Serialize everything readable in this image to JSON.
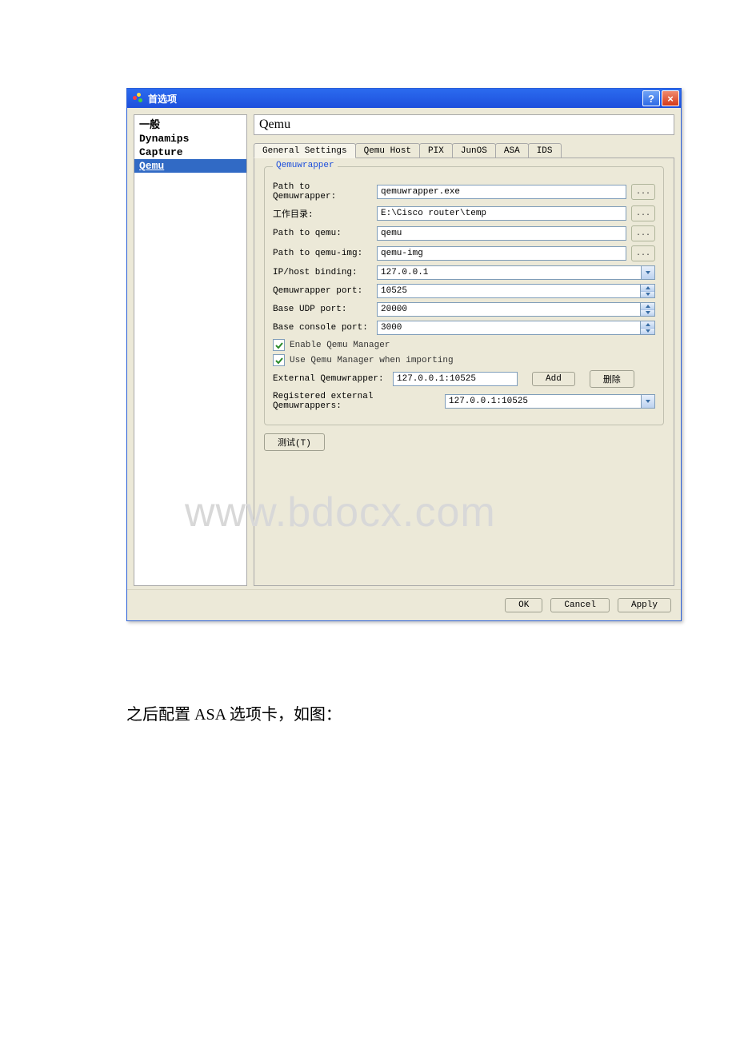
{
  "titlebar": {
    "title": "首选项"
  },
  "sidebar": {
    "items": [
      {
        "label": "一般"
      },
      {
        "label": "Dynamips"
      },
      {
        "label": "Capture"
      },
      {
        "label": "Qemu"
      }
    ]
  },
  "page_title": "Qemu",
  "tabs": [
    {
      "label": "General Settings"
    },
    {
      "label": "Qemu Host"
    },
    {
      "label": "PIX"
    },
    {
      "label": "JunOS"
    },
    {
      "label": "ASA"
    },
    {
      "label": "IDS"
    }
  ],
  "group": {
    "title": "Qemuwrapper",
    "path_qemuwrapper_label": "Path to Qemuwrapper:",
    "path_qemuwrapper_value": "qemuwrapper.exe",
    "workdir_label": "工作目录:",
    "workdir_value": "E:\\Cisco router\\temp",
    "path_qemu_label": "Path to qemu:",
    "path_qemu_value": "qemu",
    "path_qemuimg_label": "Path to qemu-img:",
    "path_qemuimg_value": "qemu-img",
    "ipbind_label": "IP/host binding:",
    "ipbind_value": "127.0.0.1",
    "wrapperport_label": "Qemuwrapper port:",
    "wrapperport_value": "10525",
    "baseudp_label": "Base UDP port:",
    "baseudp_value": "20000",
    "baseconsole_label": "Base console port:",
    "baseconsole_value": "3000",
    "enable_manager_label": "Enable Qemu Manager",
    "use_manager_import_label": "Use Qemu Manager when importing",
    "external_label": "External Qemuwrapper:",
    "external_value": "127.0.0.1:10525",
    "add_label": "Add",
    "delete_label": "删除",
    "registered_label": "Registered external Qemuwrappers:",
    "registered_value": "127.0.0.1:10525",
    "browse_label": "...",
    "test_label": "测试(T)"
  },
  "footer": {
    "ok": "OK",
    "cancel": "Cancel",
    "apply": "Apply"
  },
  "watermark": "www.bdocx.com",
  "caption": "之后配置 ASA 选项卡，如图："
}
